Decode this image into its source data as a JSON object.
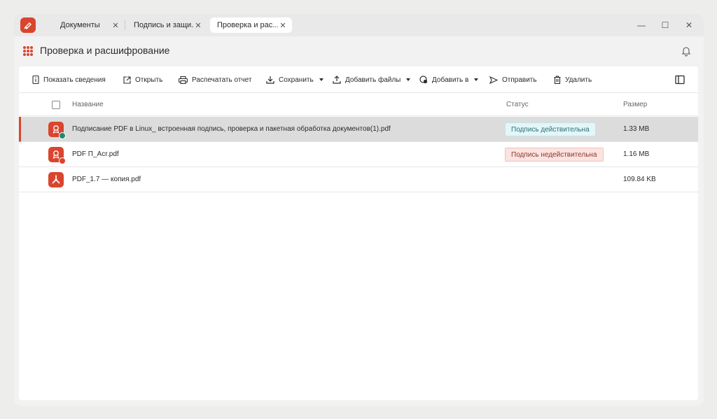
{
  "tabs": [
    {
      "label": "Документы",
      "close": "✕"
    },
    {
      "label": "Подпись и защи...",
      "close": "✕"
    },
    {
      "label": "Проверка и рас...",
      "close": "✕"
    }
  ],
  "window_controls": {
    "minimize": "—",
    "maximize": "☐",
    "close": "✕"
  },
  "header": {
    "title": "Проверка и расшифрование"
  },
  "toolbar": {
    "show_info": "Показать сведения",
    "open": "Открыть",
    "print_report": "Распечатать отчет",
    "save": "Сохранить",
    "add_files": "Добавить файлы",
    "add_to": "Добавить в",
    "send": "Отправить",
    "delete": "Удалить"
  },
  "table": {
    "columns": {
      "name": "Название",
      "status": "Статус",
      "size": "Размер"
    },
    "rows": [
      {
        "name": "Подписание PDF в Linux_ встроенная подпись, проверка и пакетная обработка документов(1).pdf",
        "status": "Подпись действительна",
        "size": "1.33 MB"
      },
      {
        "name": "PDF П_Acr.pdf",
        "status": "Подпись недействительна",
        "size": "1.16 MB"
      },
      {
        "name": "PDF_1.7 — копия.pdf",
        "status": "",
        "size": "109.84 KB"
      }
    ]
  },
  "colors": {
    "accent": "#d9452e",
    "valid": "#1f8a73",
    "invalid_bg": "#fbe3e0",
    "valid_bg": "#e3f6f8"
  }
}
